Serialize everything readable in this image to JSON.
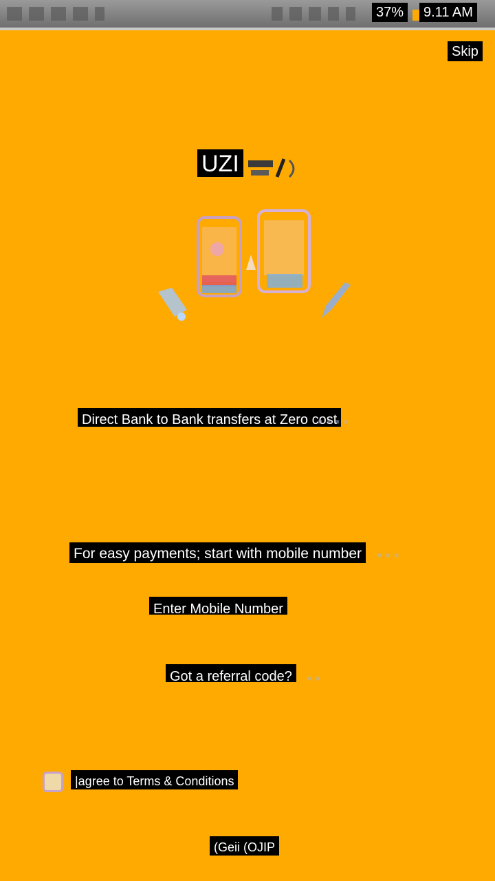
{
  "status_bar": {
    "battery": "37%",
    "time": "9.11 AM",
    "icons": [
      "notification-icon",
      "notification-icon",
      "notification-icon",
      "notification-icon",
      "notification-icon",
      "signal-icon",
      "wifi-icon",
      "network-icon",
      "data-icon",
      "bluetooth-icon"
    ]
  },
  "header": {
    "skip_label": "Skip"
  },
  "logo": {
    "text": "UZI"
  },
  "tagline": "Direct Bank to Bank transfers at Zero cost",
  "prompt": "For easy payments; start with mobile number",
  "mobile_field": {
    "label": "Enter Mobile Number"
  },
  "referral_label": "Got a referral code?",
  "terms_label": "|agree to Terms & Conditions",
  "go_button_label": "(Geii (OJIP",
  "colors": {
    "background": "#FFAA00",
    "label_bg": "#000000",
    "label_text": "#ffffff"
  }
}
